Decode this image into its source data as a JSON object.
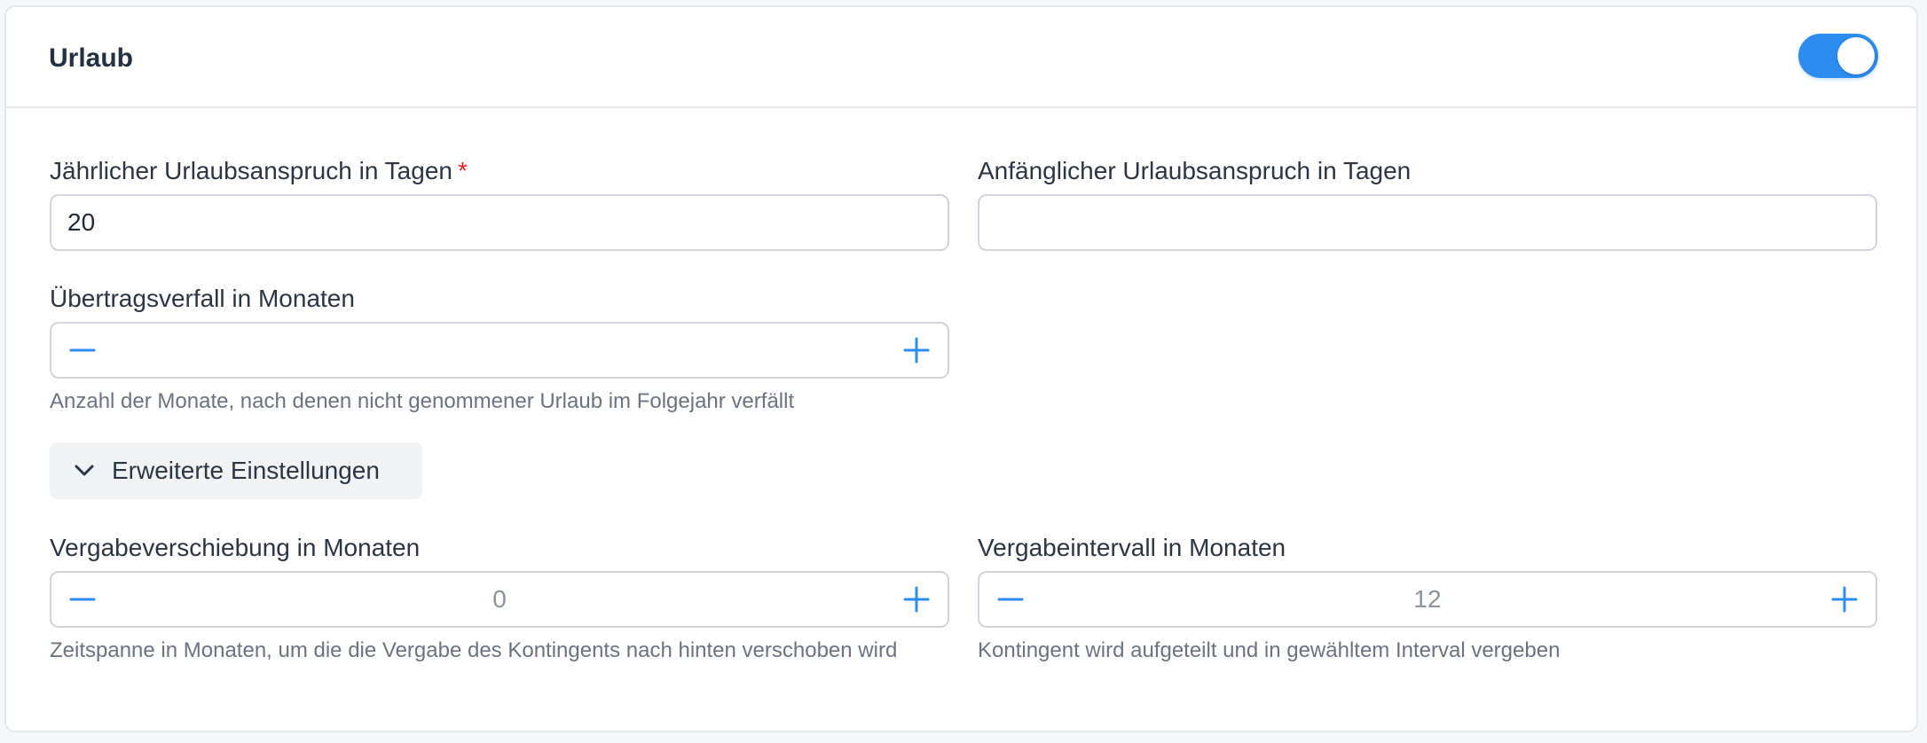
{
  "section": {
    "title": "Urlaub",
    "enabled": true
  },
  "fields": {
    "annual_days": {
      "label": "Jährlicher Urlaubsanspruch in Tagen",
      "required_mark": "*",
      "value": "20"
    },
    "initial_days": {
      "label": "Anfänglicher Urlaubsanspruch in Tagen",
      "value": ""
    },
    "carryover_expiry": {
      "label": "Übertragsverfall in Monaten",
      "value": "",
      "hint": "Anzahl der Monate, nach denen nicht genommener Urlaub im Folgejahr verfällt"
    },
    "advanced_toggle": {
      "label": "Erweiterte Einstellungen"
    },
    "allocation_shift": {
      "label": "Vergabeverschiebung in Monaten",
      "value": "0",
      "hint": "Zeitspanne in Monaten, um die die Vergabe des Kontingents nach hinten verschoben wird"
    },
    "allocation_interval": {
      "label": "Vergabeintervall in Monaten",
      "value": "12",
      "hint": "Kontingent wird aufgeteilt und in gewähltem Interval vergeben"
    }
  },
  "icons": {
    "minus": "minus-icon",
    "plus": "plus-icon",
    "chevron": "chevron-down-icon"
  },
  "colors": {
    "accent": "#2d8cf0",
    "required": "#e02424"
  }
}
